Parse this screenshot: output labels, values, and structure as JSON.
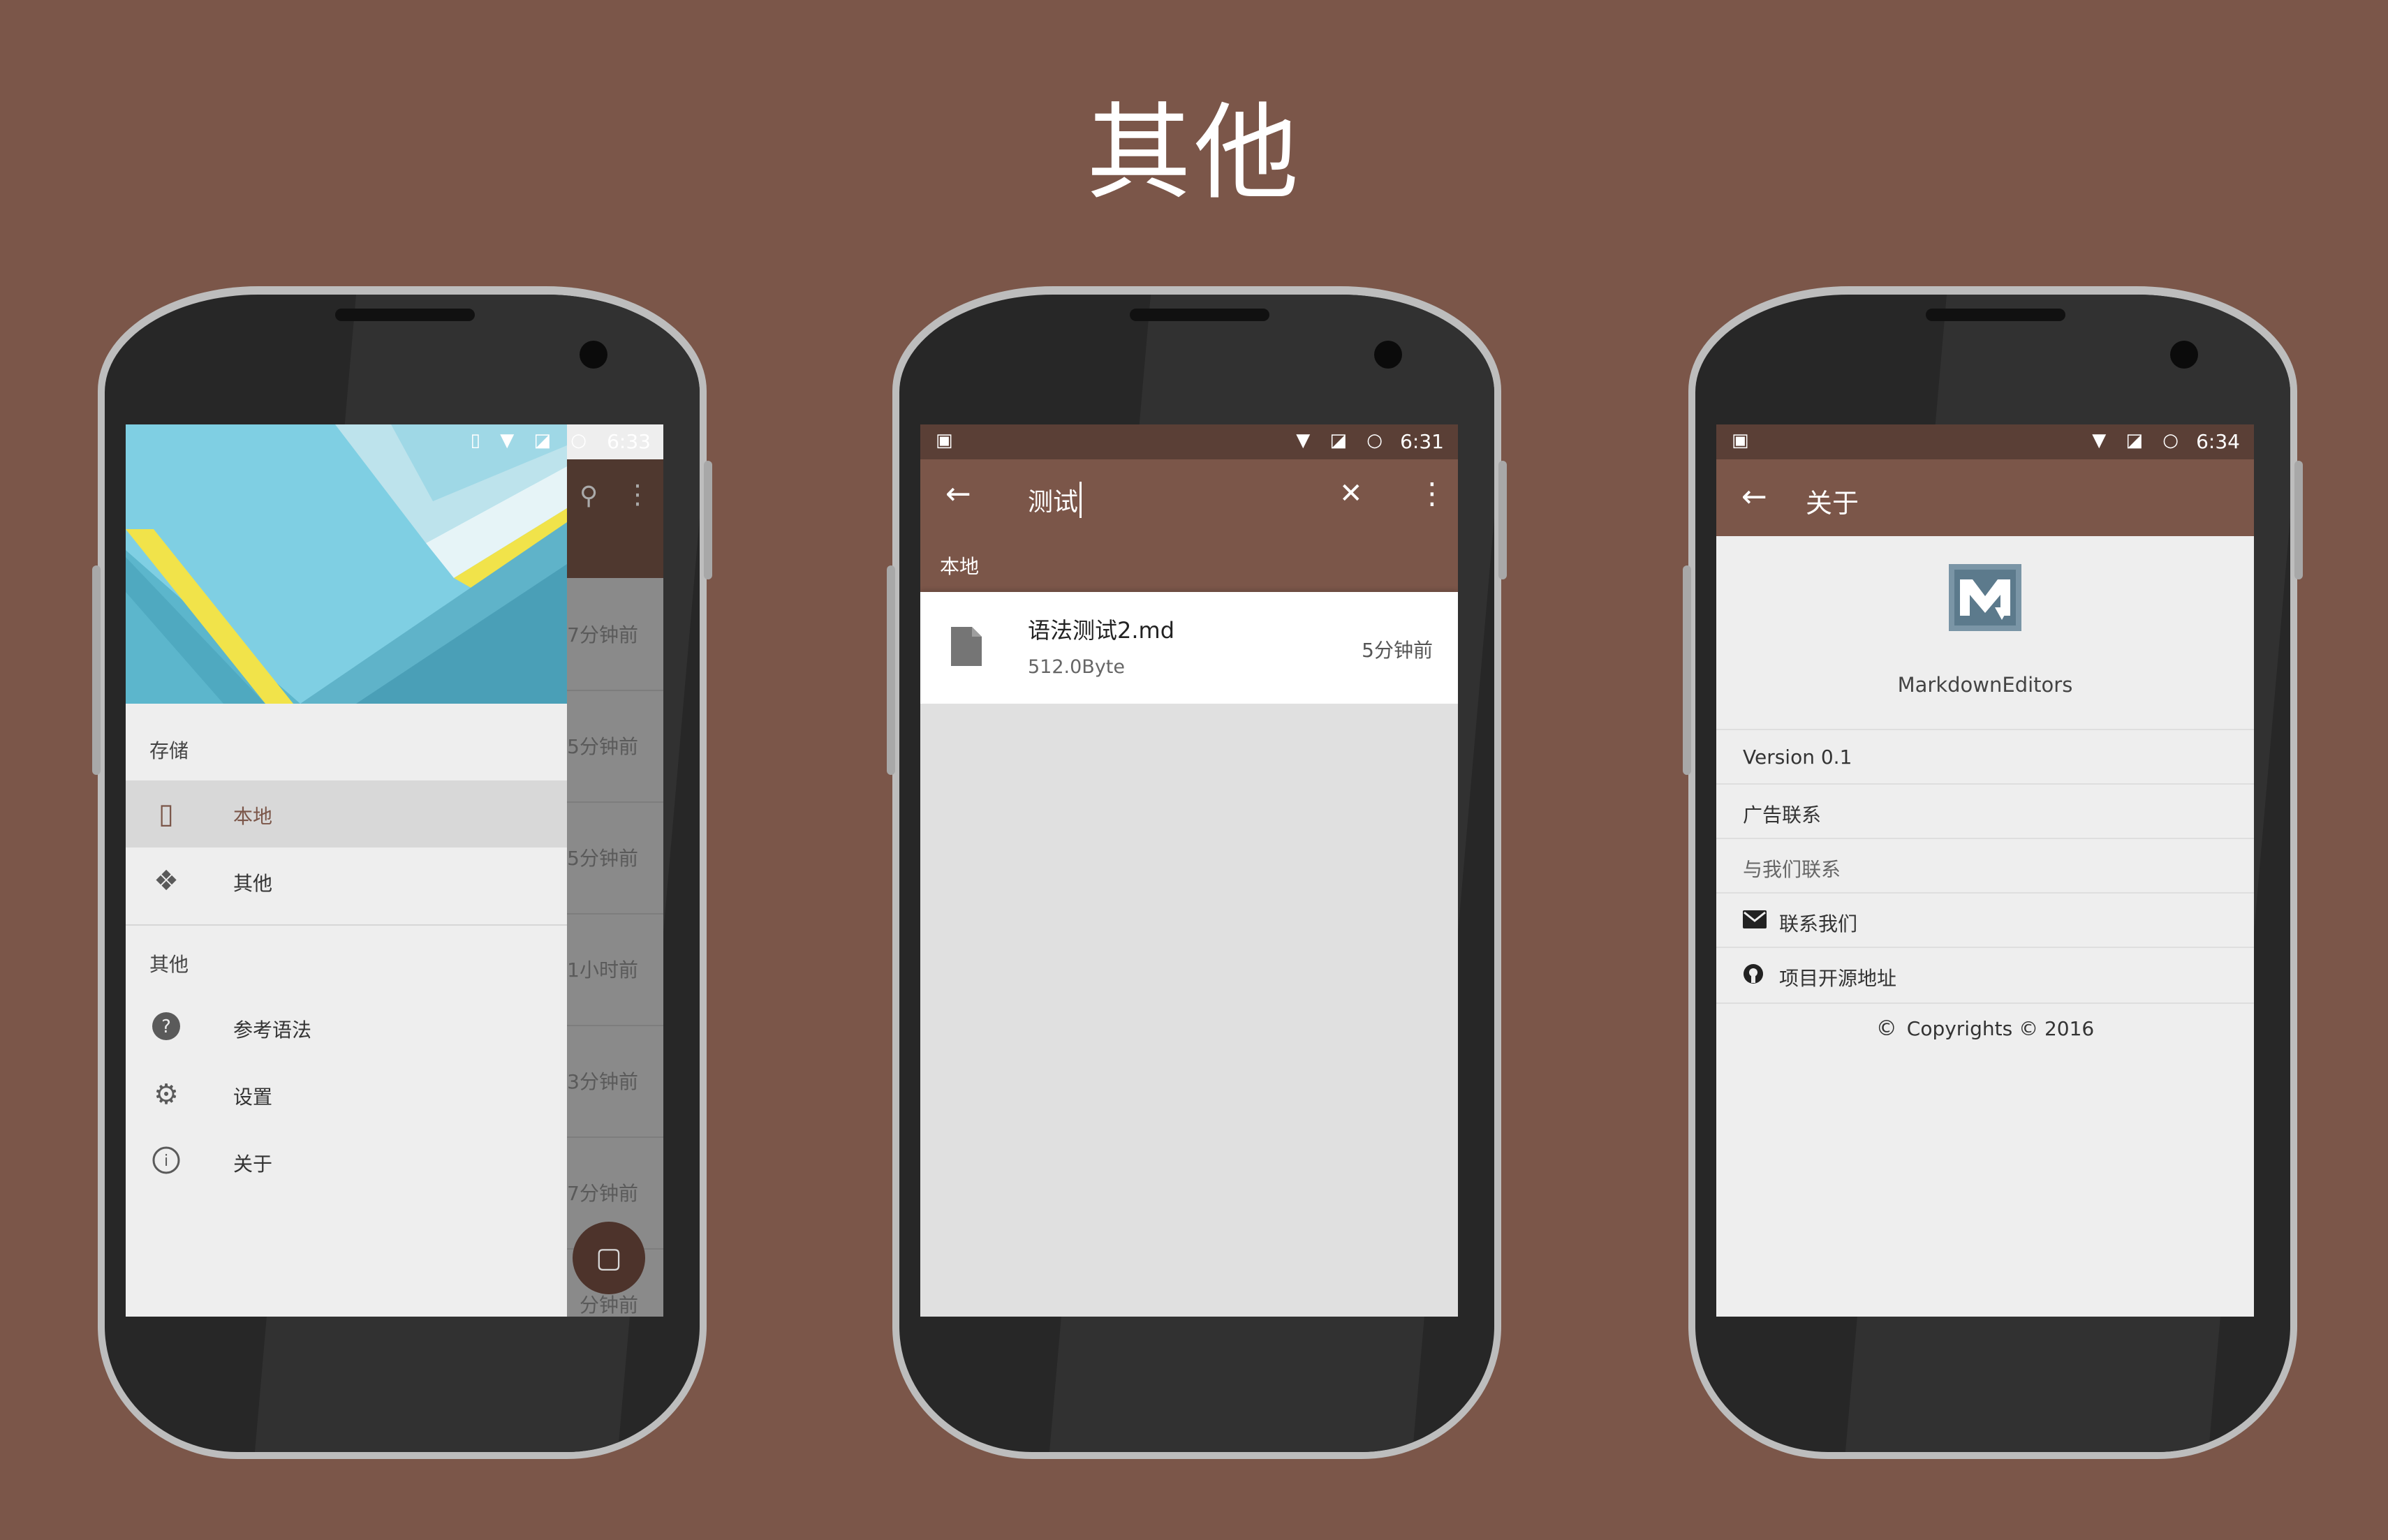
{
  "title": "其他",
  "phone1": {
    "status_time": "6:33",
    "drawer": {
      "section_storage": "存储",
      "items_storage": [
        {
          "label": "本地",
          "icon": "phone-icon",
          "selected": true
        },
        {
          "label": "其他",
          "icon": "dropbox-icon",
          "selected": false
        }
      ],
      "section_other": "其他",
      "items_other": [
        {
          "label": "参考语法",
          "icon": "help-icon"
        },
        {
          "label": "设置",
          "icon": "settings-icon"
        },
        {
          "label": "关于",
          "icon": "info-icon"
        }
      ]
    },
    "list_times": [
      "7分钟前",
      "5分钟前",
      "5分钟前",
      "1小时前",
      "3分钟前",
      "7分钟前",
      "分钟前"
    ]
  },
  "phone2": {
    "status_time": "6:31",
    "search_value": "测试",
    "tab": "本地",
    "result": {
      "name": "语法测试2.md",
      "size": "512.0Byte",
      "time": "5分钟前"
    }
  },
  "phone3": {
    "status_time": "6:34",
    "appbar_title": "关于",
    "app_name": "MarkdownEditors",
    "version": "Version 0.1",
    "ad_contact": "广告联系",
    "contact_section": "与我们联系",
    "contact_us": "联系我们",
    "source_address": "项目开源地址",
    "copyright": "Copyrights © 2016"
  },
  "colors": {
    "background": "#7b5649",
    "appbar": "#7b5649",
    "statusbar": "#5a3f36"
  }
}
